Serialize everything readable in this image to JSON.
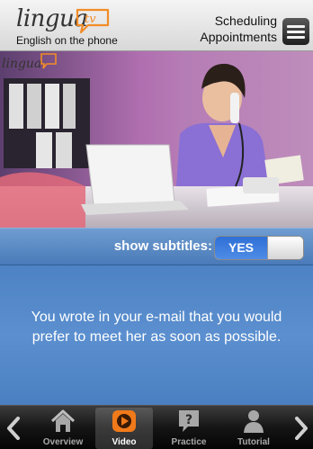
{
  "header": {
    "brand": "lingua",
    "brand_suffix": "tv",
    "tagline": "English on the phone",
    "lesson_title": [
      "Scheduling",
      "Appointments"
    ],
    "menu_icon": "menu-icon"
  },
  "video": {
    "watermark": "lingua"
  },
  "subtitles": {
    "toggle_label": "show subtitles:",
    "toggle_value": "YES",
    "enabled": true,
    "text": "You wrote in your e-mail that you would prefer to meet her as soon as possible."
  },
  "tabbar": {
    "prev_icon": "chevron-left-icon",
    "next_icon": "chevron-right-icon",
    "active_tab": "Video",
    "tabs": [
      {
        "label": "Overview",
        "icon": "home-icon"
      },
      {
        "label": "Video",
        "icon": "play-icon"
      },
      {
        "label": "Practice",
        "icon": "question-icon"
      },
      {
        "label": "Tutorial",
        "icon": "person-icon"
      }
    ]
  },
  "colors": {
    "subtitle_blue": "#4d82c4",
    "toggle_blue": "#2f6fd6",
    "brand_orange": "#f28c28"
  }
}
